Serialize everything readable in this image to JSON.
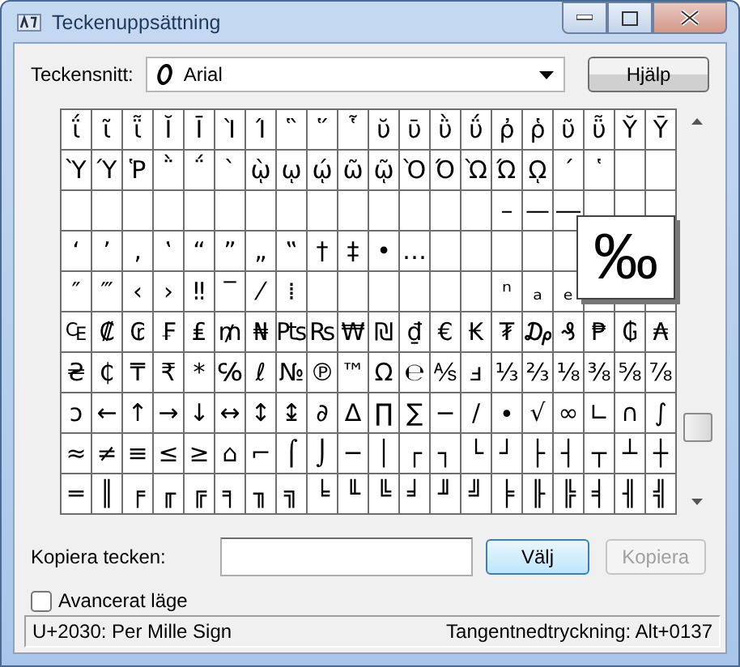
{
  "window": {
    "title": "Teckenuppsättning"
  },
  "font": {
    "label": "Teckensnitt:",
    "value": "Arial"
  },
  "help_button": "Hjälp",
  "grid": {
    "rows": [
      [
        "ΐ",
        "ῖ",
        "ῗ",
        "Ῐ",
        "Ῑ",
        "Ὶ",
        "Ί",
        "῝",
        "῞",
        "῟",
        "ῠ",
        "ῡ",
        "ῢ",
        "ΰ",
        "ῤ",
        "ῥ",
        "ῦ",
        "ῧ",
        "Ῠ",
        "Ῡ"
      ],
      [
        "Ὺ",
        "Ύ",
        "Ῥ",
        "῭",
        "΅",
        "`",
        "ῲ",
        "ῳ",
        "ῴ",
        "ῶ",
        "ῷ",
        "Ὸ",
        "Ό",
        "Ὼ",
        "Ώ",
        "ῼ",
        "´",
        "῾",
        null,
        null
      ],
      [
        null,
        null,
        null,
        null,
        null,
        null,
        null,
        null,
        null,
        null,
        null,
        null,
        null,
        null,
        "–",
        "—",
        "―",
        null,
        null,
        null
      ],
      [
        "‘",
        "’",
        "‚",
        "‛",
        "“",
        "”",
        "„",
        "‟",
        "†",
        "‡",
        "•",
        "…",
        null,
        null,
        null,
        null,
        null,
        null,
        null,
        null
      ],
      [
        "″",
        "‴",
        "‹",
        "›",
        "‼",
        "‾",
        "⁄",
        "⁞",
        null,
        null,
        null,
        null,
        null,
        null,
        "ⁿ",
        "ₐ",
        "ₑ",
        null,
        null,
        null
      ],
      [
        "₠",
        "₡",
        "₢",
        "₣",
        "₤",
        "₥",
        "₦",
        "₧",
        "₨",
        "₩",
        "₪",
        "₫",
        "€",
        "₭",
        "₮",
        "₯",
        "₰",
        "₱",
        "₲",
        "₳"
      ],
      [
        "₴",
        "₵",
        "₸",
        "₹",
        "*",
        "℅",
        "ℓ",
        "№",
        "℗",
        "™",
        "Ω",
        "℮",
        "⅍",
        "ⅎ",
        "⅓",
        "⅔",
        "⅛",
        "⅜",
        "⅝",
        "⅞"
      ],
      [
        "ↄ",
        "←",
        "↑",
        "→",
        "↓",
        "↔",
        "↕",
        "↨",
        "∂",
        "∆",
        "∏",
        "∑",
        "−",
        "∕",
        "∙",
        "√",
        "∞",
        "∟",
        "∩",
        "∫"
      ],
      [
        "≈",
        "≠",
        "≡",
        "≤",
        "≥",
        "⌂",
        "⌐",
        "⌠",
        "⌡",
        "─",
        "│",
        "┌",
        "┐",
        "└",
        "┘",
        "├",
        "┤",
        "┬",
        "┴",
        "┼"
      ],
      [
        "═",
        "║",
        "╒",
        "╓",
        "╔",
        "╕",
        "╖",
        "╗",
        "╘",
        "╙",
        "╚",
        "╛",
        "╜",
        "╝",
        "╞",
        "╟",
        "╠",
        "╡",
        "╢",
        "╣"
      ]
    ],
    "preview": "‰"
  },
  "copy": {
    "label": "Kopiera tecken:",
    "select_button": "Välj",
    "copy_button": "Kopiera",
    "copy_disabled": true
  },
  "advanced": {
    "label": "Avancerat läge",
    "checked": false
  },
  "status_bar": {
    "left": "U+2030: Per Mille Sign",
    "right": "Tangentnedtryckning: Alt+0137"
  }
}
